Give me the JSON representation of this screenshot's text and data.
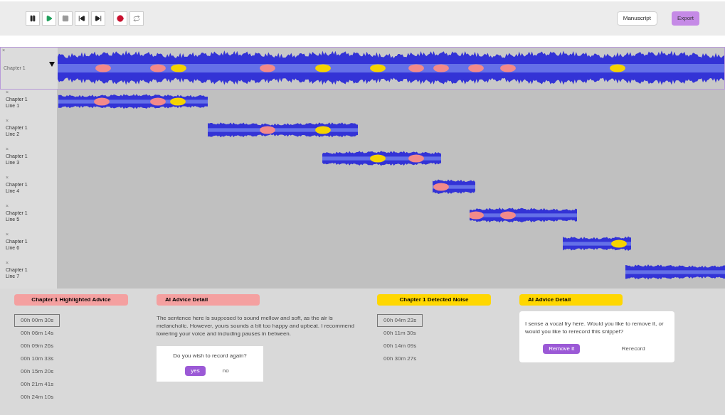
{
  "toolbar": {
    "transport": [
      {
        "kind": "pause"
      },
      {
        "kind": "play"
      },
      {
        "kind": "stop"
      },
      {
        "kind": "previous"
      },
      {
        "kind": "next"
      },
      {
        "kind": "record"
      },
      {
        "kind": "loop"
      }
    ],
    "buttons": [
      {
        "label": "Manuscript",
        "kind": "outline"
      },
      {
        "label": "Export",
        "kind": "primary"
      }
    ]
  },
  "main_track": {
    "close": "×",
    "label": "Chapter 1",
    "expanded": true
  },
  "lines": [
    {
      "close": "×",
      "title": "Chapter 1",
      "subtitle": "Line 1"
    },
    {
      "close": "×",
      "title": "Chapter 1",
      "subtitle": "Line 2"
    },
    {
      "close": "×",
      "title": "Chapter 1",
      "subtitle": "Line 3"
    },
    {
      "close": "×",
      "title": "Chapter 1",
      "subtitle": "Line 4"
    },
    {
      "close": "×",
      "title": "Chapter 1",
      "subtitle": "Line 5"
    },
    {
      "close": "×",
      "title": "Chapter 1",
      "subtitle": "Line 6"
    },
    {
      "close": "×",
      "title": "Chapter 1",
      "subtitle": "Line 7"
    }
  ],
  "panels": [
    {
      "color": "#f4a0a0",
      "list_title": "Chapter 1 Highlighted Advice",
      "detail_title": "AI Advice Detail",
      "times": [
        {
          "text": "00h 00m 30s",
          "selected": true
        },
        {
          "text": "00h 06m 14s",
          "selected": false
        },
        {
          "text": "00h 09m 26s",
          "selected": false
        },
        {
          "text": "00h 10m 33s",
          "selected": false
        },
        {
          "text": "00h 15m 20s",
          "selected": false
        },
        {
          "text": "00h 21m 41s",
          "selected": false
        },
        {
          "text": "00h 24m 10s",
          "selected": false
        }
      ],
      "detail": {
        "kind": "advice",
        "text": "The sentence here is supposed to sound mellow and soft, as the air is melancholic. However, yours sounds a bit too happy and upbeat. I recommend lowering your voice and including pauses in between.",
        "question": "Do you wish to record again?",
        "actions": [
          {
            "label": "yes",
            "primary": true
          },
          {
            "label": "no",
            "primary": false
          }
        ]
      }
    },
    {
      "color": "#ffd700",
      "list_title": "Chapter 1 Detected Noise",
      "detail_title": "AI Advice Detail",
      "times": [
        {
          "text": "00h 04m 23s",
          "selected": true
        },
        {
          "text": "00h 11m 30s",
          "selected": false
        },
        {
          "text": "00h 14m 09s",
          "selected": false
        },
        {
          "text": "00h 30m 27s",
          "selected": false
        }
      ],
      "detail": {
        "kind": "noise",
        "text": "I sense a vocal fry here. Would you like to remove it, or would you like to rerecord this snippet?",
        "actions": [
          {
            "label": "Remove it",
            "primary": true
          },
          {
            "label": "Rerecord",
            "primary": false
          }
        ]
      }
    }
  ]
}
